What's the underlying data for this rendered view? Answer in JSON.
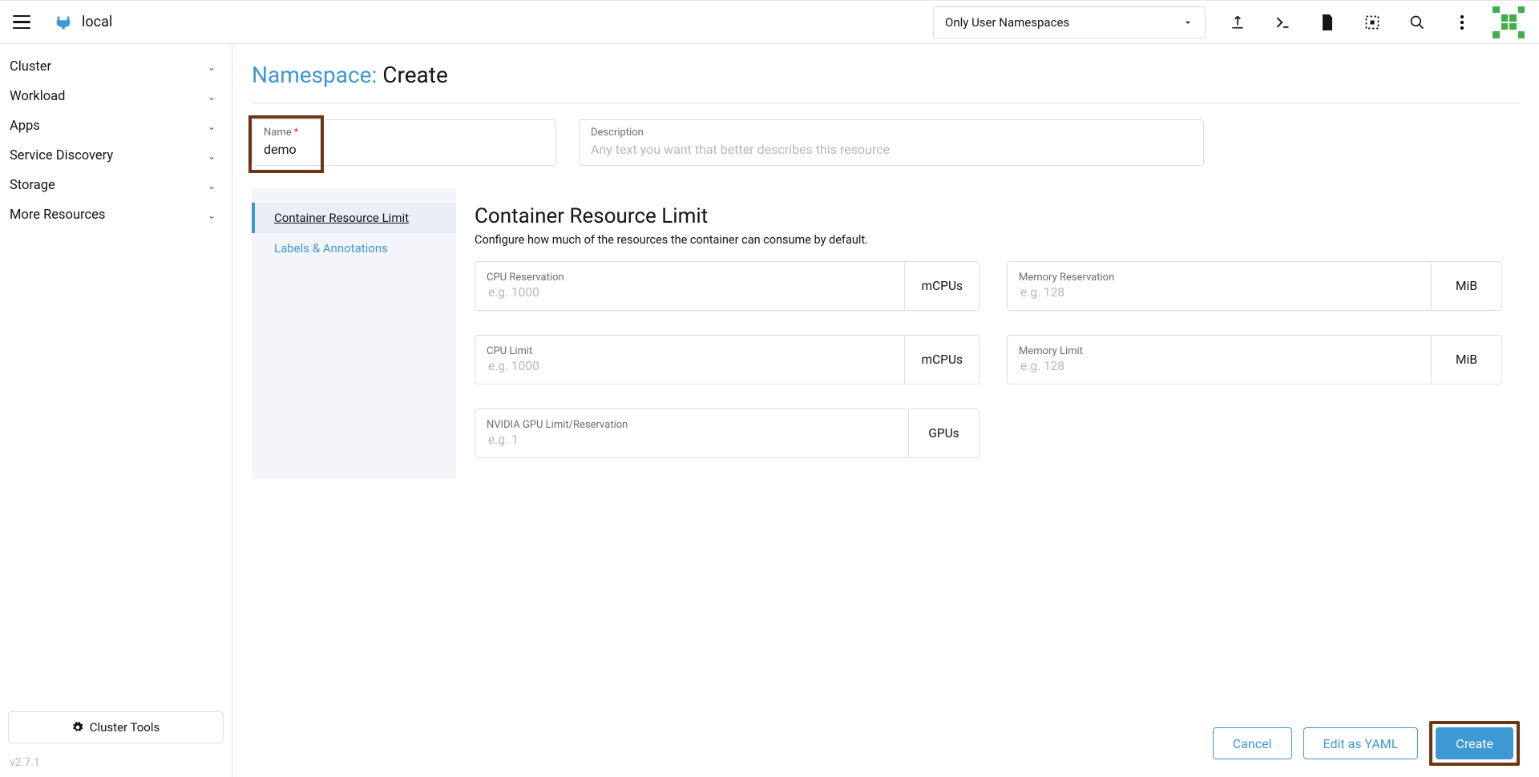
{
  "header": {
    "cluster": "local",
    "ns_filter": "Only User Namespaces"
  },
  "sidebar": {
    "items": [
      "Cluster",
      "Workload",
      "Apps",
      "Service Discovery",
      "Storage",
      "More Resources"
    ],
    "tools": "Cluster Tools",
    "version": "v2.7.1"
  },
  "page": {
    "title_prefix": "Namespace: ",
    "title_action": "Create"
  },
  "form": {
    "name_label": "Name",
    "name_value": "demo",
    "desc_label": "Description",
    "desc_placeholder": "Any text you want that better describes this resource"
  },
  "tabs": {
    "crl": "Container Resource Limit",
    "la": "Labels & Annotations"
  },
  "crl": {
    "heading": "Container Resource Limit",
    "hint": "Configure how much of the resources the container can consume by default.",
    "cpu_res": {
      "label": "CPU Reservation",
      "ph": "e.g. 1000",
      "unit": "mCPUs"
    },
    "mem_res": {
      "label": "Memory Reservation",
      "ph": "e.g. 128",
      "unit": "MiB"
    },
    "cpu_lim": {
      "label": "CPU Limit",
      "ph": "e.g. 1000",
      "unit": "mCPUs"
    },
    "mem_lim": {
      "label": "Memory Limit",
      "ph": "e.g. 128",
      "unit": "MiB"
    },
    "gpu": {
      "label": "NVIDIA GPU Limit/Reservation",
      "ph": "e.g. 1",
      "unit": "GPUs"
    }
  },
  "footer": {
    "cancel": "Cancel",
    "yaml": "Edit as YAML",
    "create": "Create"
  }
}
